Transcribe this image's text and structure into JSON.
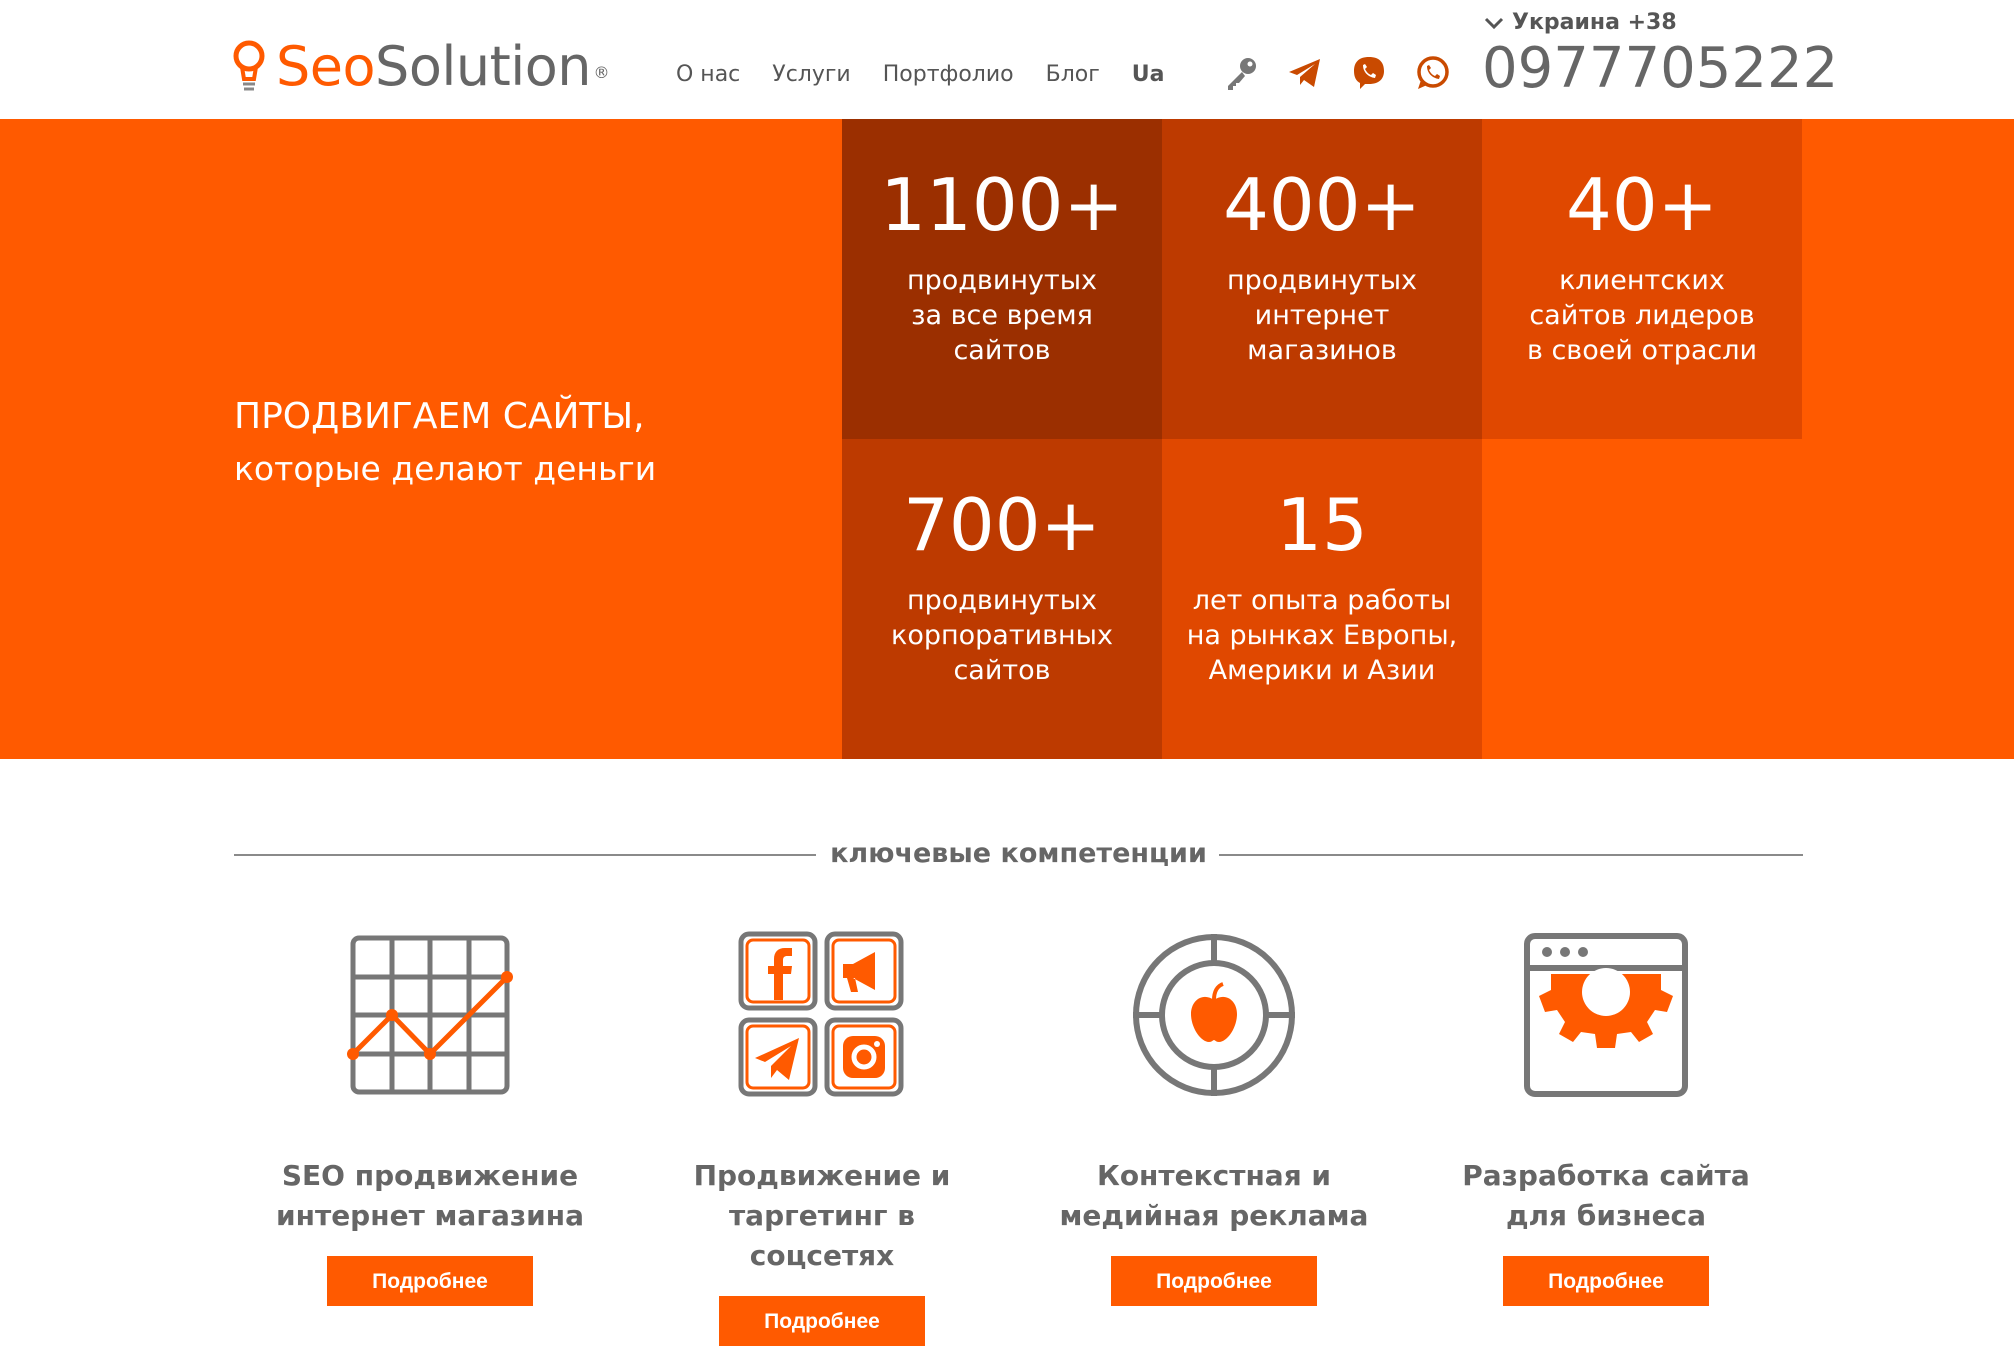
{
  "header": {
    "logo": {
      "seo": "Seo",
      "solution": "Solution",
      "reg": "®"
    },
    "nav": [
      {
        "label": "О нас"
      },
      {
        "label": "Услуги"
      },
      {
        "label": "Портфолио"
      },
      {
        "label": "Блог"
      },
      {
        "label": "Ua"
      }
    ],
    "icons": [
      "key-icon",
      "telegram-icon",
      "viber-icon",
      "whatsapp-icon"
    ],
    "country": "Украина +38",
    "phone": "0977705222"
  },
  "hero": {
    "title_line1": "ПРОДВИГАЕМ САЙТЫ,",
    "title_line2": "которые делают деньги",
    "background": "#ff5a00",
    "stats": [
      {
        "num": "1100+",
        "l1": "продвинутых",
        "l2": "за все время",
        "l3": "сайтов",
        "color": "#9b2f00"
      },
      {
        "num": "400+",
        "l1": "продвинутых",
        "l2": "интернет",
        "l3": "магазинов",
        "color": "#bd3a00"
      },
      {
        "num": "40+",
        "l1": "клиентских",
        "l2": "сайтов лидеров",
        "l3": "в своей отрасли",
        "color": "#e04800"
      },
      {
        "num": "700+",
        "l1": "продвинутых",
        "l2": "корпоративных",
        "l3": "сайтов",
        "color": "#bd3a00"
      },
      {
        "num": "15",
        "l1": "лет опыта работы",
        "l2": "на рынках Европы,",
        "l3": "Америки и Азии",
        "color": "#e04800"
      }
    ]
  },
  "competencies": {
    "title": "ключевые компетенции",
    "items": [
      {
        "icon": "seo-chart-icon",
        "line1": "SEO продвижение",
        "line2": "интернет магазина",
        "button": "Подробнее"
      },
      {
        "icon": "social-media-icon",
        "line1": "Продвижение и",
        "line2": "таргетинг в соцсетях",
        "button": "Подробнее"
      },
      {
        "icon": "target-apple-icon",
        "line1": "Контекстная и",
        "line2": "медийная реклама",
        "button": "Подробнее"
      },
      {
        "icon": "browser-gear-icon",
        "line1": "Разработка сайта",
        "line2": "для бизнеса",
        "button": "Подробнее"
      }
    ]
  },
  "colors": {
    "accent": "#ff5a00",
    "text": "#666666",
    "icon_gray": "#777777"
  }
}
